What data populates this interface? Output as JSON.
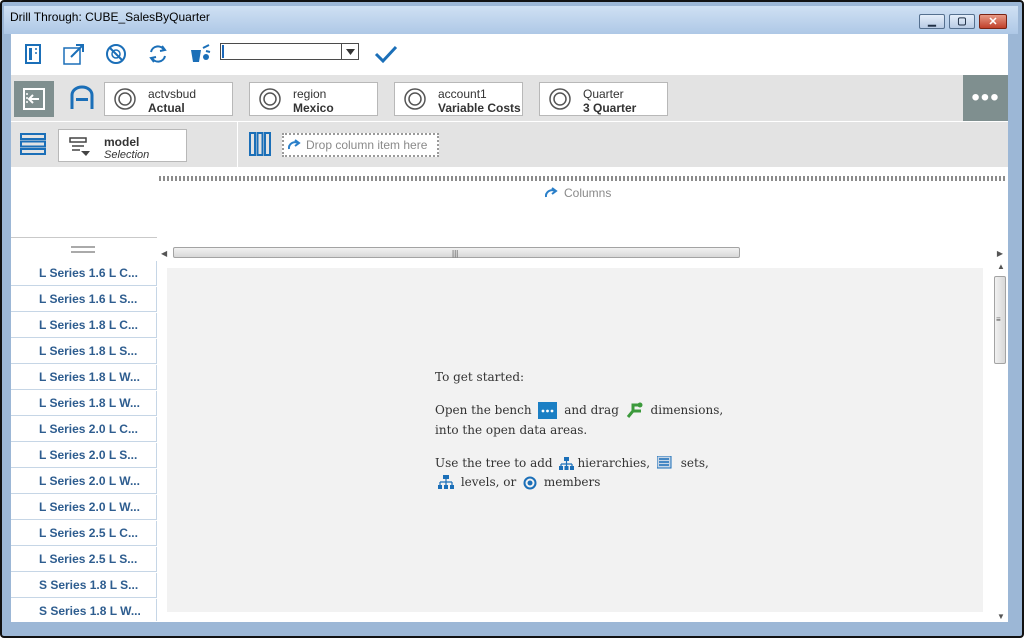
{
  "window": {
    "title": "Drill Through: CUBE_SalesByQuarter",
    "buttons": [
      "minimize",
      "maximize",
      "close"
    ]
  },
  "toolbar": {
    "icons": [
      "layout-icon",
      "expand-icon",
      "suppress-icon",
      "refresh-icon",
      "paint-icon"
    ],
    "select_value": "",
    "confirm_icon": "checkmark-icon"
  },
  "slicers": [
    {
      "dimension": "actvsbud",
      "member": "Actual"
    },
    {
      "dimension": "region",
      "member": "Mexico"
    },
    {
      "dimension": "account1",
      "member": "Variable Costs"
    },
    {
      "dimension": "Quarter",
      "member": "3 Quarter"
    }
  ],
  "more_label": "•••",
  "rows": {
    "chip_label": "model",
    "chip_sub": "Selection"
  },
  "columns": {
    "drop_text": "Drop column item here",
    "hint": "Columns"
  },
  "row_items": [
    "L Series 1.6 L C...",
    "L Series 1.6 L S...",
    "L Series 1.8 L C...",
    "L Series 1.8 L S...",
    "L Series 1.8 L W...",
    "L Series 1.8 L W...",
    "L Series 2.0 L C...",
    "L Series 2.0 L S...",
    "L Series 2.0 L W...",
    "L Series 2.0 L W...",
    "L Series 2.5 L C...",
    "L Series 2.5 L S...",
    "S Series 1.8 L S...",
    "S Series 1.8 L W..."
  ],
  "help": {
    "title": "To get started:",
    "line1_a": "Open the bench",
    "line1_b": "and drag",
    "line1_c": "dimensions,",
    "line2": "into the open data areas.",
    "line3_a": "Use the tree to add",
    "line3_b": "hierarchies,",
    "line3_c": "sets,",
    "line4_a": "levels, or",
    "line4_b": "members"
  },
  "colors": {
    "accent": "#1b6fb8",
    "row_text": "#2e5d8f",
    "dark_tab": "#7f8f8f",
    "zone_bg": "#e3e3e3"
  }
}
